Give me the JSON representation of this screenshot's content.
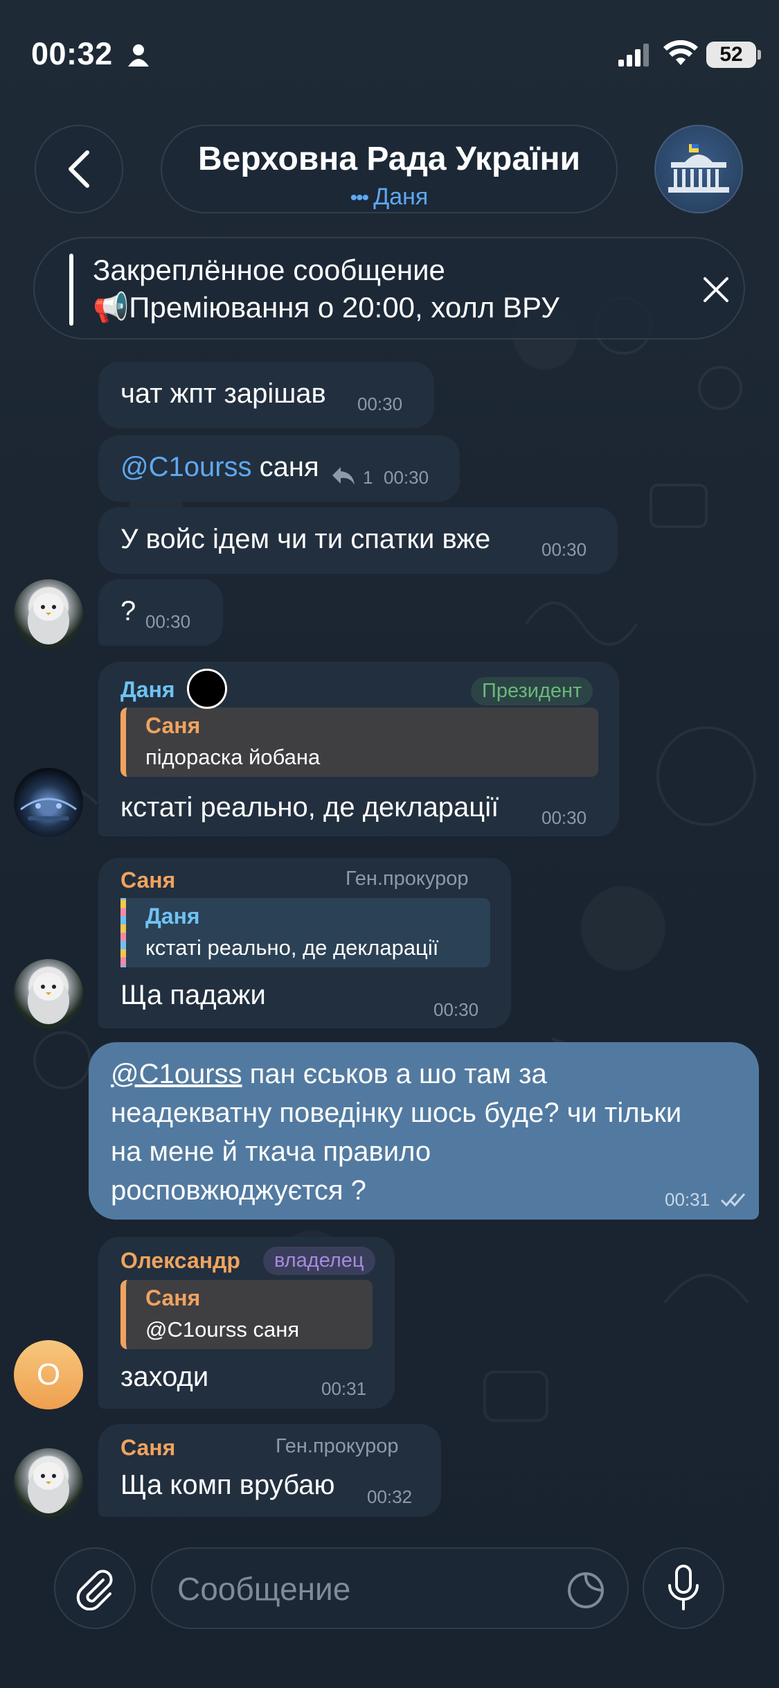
{
  "status_bar": {
    "time": "00:32",
    "battery": "52"
  },
  "header": {
    "title": "Верховна Рада України",
    "subtitle_dots": "•••",
    "subtitle": "Даня"
  },
  "pinned": {
    "title": "Закреплённое сообщение",
    "text": "📢Преміювання о 20:00, холл ВРУ"
  },
  "messages": [
    {
      "text": "чат жпт зарішав",
      "time": "00:30"
    },
    {
      "mention": "@C1ourss",
      "text": " саня",
      "replies": "1",
      "time": "00:30"
    },
    {
      "text": "У войс ідем чи ти спатки вже",
      "time": "00:30"
    },
    {
      "text": "?",
      "time": "00:30"
    },
    {
      "sender": "Даня",
      "badge": "Президент",
      "reply_name": "Саня",
      "reply_text": "підораска йобана",
      "text": "кстаті реально, де декларації",
      "time": "00:30"
    },
    {
      "sender": "Саня",
      "badge": "Ген.прокурор",
      "reply_name": "Даня",
      "reply_text": "кстаті реально, де декларації",
      "text": "Ща падажи",
      "time": "00:30"
    },
    {
      "mention": "@C1ourss",
      "line1": " пан єськов а шо там за",
      "line2": "неадекватну поведінку шось буде? чи тільки",
      "line3": "на мене й ткача правило",
      "line4": "росповжюджуєтся ?",
      "time": "00:31"
    },
    {
      "sender": "Олександр",
      "badge": "владелец",
      "reply_name": "Саня",
      "reply_text": "@C1ourss саня",
      "text": "заходи",
      "time": "00:31",
      "avatar_letter": "О"
    },
    {
      "sender": "Саня",
      "badge": "Ген.прокурор",
      "text": "Ща комп врубаю",
      "time": "00:32"
    }
  ],
  "input": {
    "placeholder": "Сообщение"
  },
  "colors": {
    "accent": "#5fa8f2",
    "outgoing_bubble": "#527aa0",
    "incoming_bubble": "#222f3e",
    "sender_dania": "#6fc2f3",
    "sender_sania": "#f0a35e",
    "badge_president": "#6ab97a",
    "badge_owner": "#a989e0"
  }
}
